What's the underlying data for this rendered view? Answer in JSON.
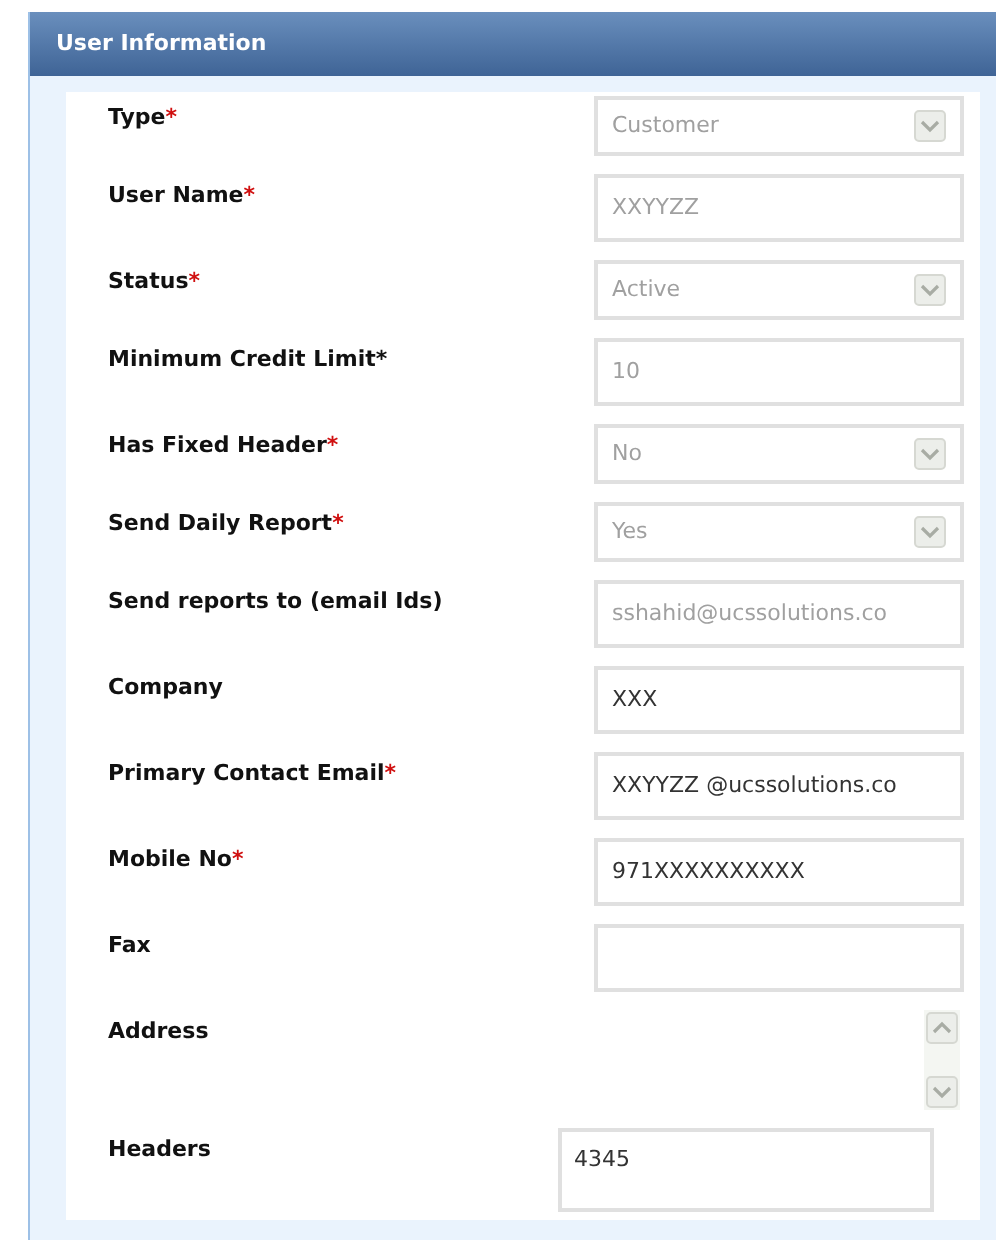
{
  "panel": {
    "title": "User Information"
  },
  "fields": [
    {
      "label": "Type",
      "mark": "*",
      "kind": "select",
      "value": "Customer",
      "disabled": true
    },
    {
      "label": "User Name",
      "mark": "*",
      "kind": "text",
      "value": "XXYYZZ",
      "disabled": true
    },
    {
      "label": "Status",
      "mark": "*",
      "kind": "select",
      "value": "Active",
      "disabled": true
    },
    {
      "label": "Minimum Credit Limit*",
      "kind": "text",
      "value": "10",
      "disabled": true
    },
    {
      "label": "Has Fixed Header",
      "mark": "*",
      "kind": "select",
      "value": "No",
      "disabled": true
    },
    {
      "label": "Send Daily Report",
      "mark": "*",
      "kind": "select",
      "value": "Yes",
      "disabled": true
    },
    {
      "label": "Send reports to (email Ids)",
      "kind": "text",
      "value": "sshahid@ucssolutions.co",
      "disabled": true
    },
    {
      "label": "Company",
      "kind": "text",
      "value": "XXX",
      "disabled": false
    },
    {
      "label": "Primary Contact Email",
      "mark": "*",
      "kind": "text",
      "value": "XXYYZZ @ucssolutions.co",
      "disabled": false
    },
    {
      "label": "Mobile No",
      "mark": "*",
      "kind": "text",
      "value": "971XXXXXXXXXX",
      "disabled": false
    },
    {
      "label": "Fax",
      "kind": "text"
    },
    {
      "label": "Address",
      "kind": "scrollarea"
    },
    {
      "label": "Headers",
      "kind": "textarea",
      "value": "4345",
      "disabled": false
    }
  ]
}
